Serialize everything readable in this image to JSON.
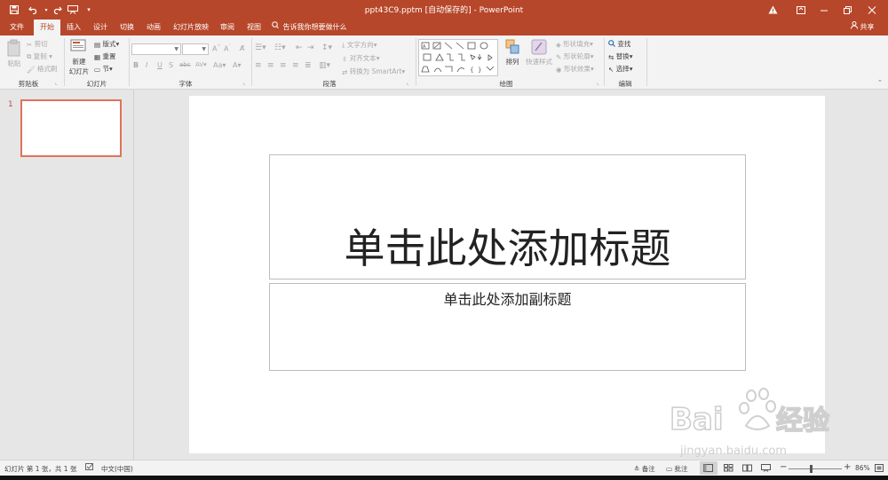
{
  "titlebar": {
    "document_title": "ppt43C9.pptm [自动保存的] - PowerPoint",
    "qat": [
      "save-icon",
      "undo-icon",
      "redo-icon",
      "start-from-beginning-icon",
      "customize-qat-icon"
    ],
    "warning_icon": "warning-icon",
    "buttons": [
      "ribbon-display-options",
      "minimize",
      "restore",
      "close"
    ]
  },
  "tabs": [
    {
      "label": "文件"
    },
    {
      "label": "开始",
      "active": true
    },
    {
      "label": "插入"
    },
    {
      "label": "设计"
    },
    {
      "label": "切换"
    },
    {
      "label": "动画"
    },
    {
      "label": "幻灯片放映"
    },
    {
      "label": "审阅"
    },
    {
      "label": "视图"
    }
  ],
  "tell_me": "告诉我你想要做什么",
  "share": "共享",
  "ribbon": {
    "clipboard": {
      "label": "剪贴板",
      "paste": "粘贴",
      "cut": "剪切",
      "copy": "复制",
      "format_painter": "格式刷"
    },
    "slides": {
      "label": "幻灯片",
      "new_slide_line1": "新建",
      "new_slide_line2": "幻灯片",
      "layout": "版式",
      "reset": "重置",
      "section": "节"
    },
    "font": {
      "label": "字体",
      "font_name": "",
      "font_size": ""
    },
    "paragraph": {
      "label": "段落",
      "text_direction": "文字方向",
      "align_text": "对齐文本",
      "convert_smartart": "转换为 SmartArt"
    },
    "drawing": {
      "label": "绘图",
      "arrange": "排列",
      "quick_styles": "快速样式",
      "shape_fill": "形状填充",
      "shape_outline": "形状轮廓",
      "shape_effects": "形状效果"
    },
    "editing": {
      "label": "编辑",
      "find": "查找",
      "replace": "替换",
      "select": "选择"
    }
  },
  "thumbnails": [
    {
      "number": "1"
    }
  ],
  "slide": {
    "title_placeholder": "单击此处添加标题",
    "subtitle_placeholder": "单击此处添加副标题"
  },
  "statusbar": {
    "slide_info": "幻灯片 第 1 张，共 1 张",
    "language": "中文(中国)",
    "notes": "备注",
    "comments": "批注",
    "zoom": "86%"
  },
  "watermark": {
    "brand": "Baidu",
    "brand_cn": "经验",
    "url": "jingyan.baidu.com"
  },
  "colors": {
    "accent": "#b7472a",
    "ribbon_bg": "#f3f3f3",
    "thumb_border": "#e0735a"
  }
}
